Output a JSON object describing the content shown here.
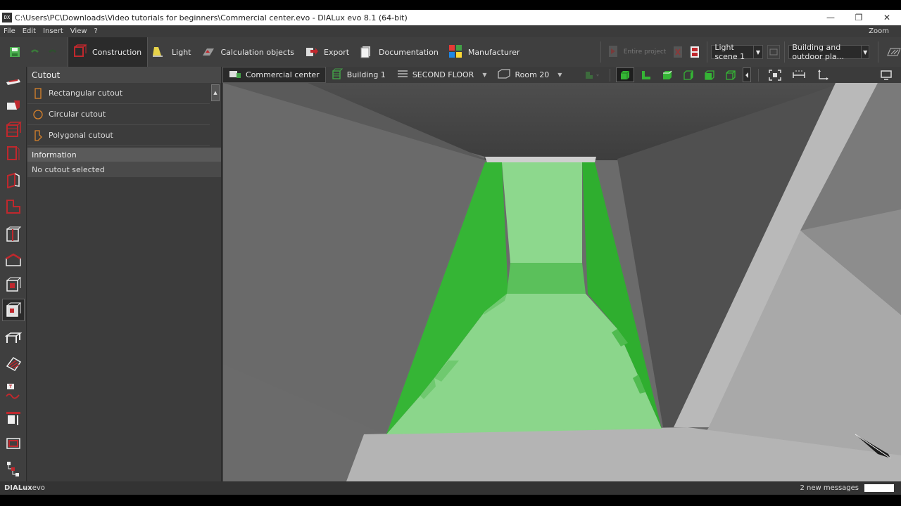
{
  "window": {
    "title": "C:\\Users\\PC\\Downloads\\Video tutorials for beginners\\Commercial center.evo - DIALux evo 8.1  (64-bit)",
    "app_icon": "DX",
    "min": "—",
    "max": "❐",
    "close": "✕"
  },
  "menu": {
    "items": [
      "File",
      "Edit",
      "Insert",
      "View",
      "?"
    ],
    "zoom": "Zoom"
  },
  "toolbar": {
    "construction": "Construction",
    "light": "Light",
    "calculation": "Calculation objects",
    "export": "Export",
    "documentation": "Documentation",
    "manufacturer": "Manufacturer",
    "entire_project": "Entire project",
    "light_scene": "Light scene 1",
    "building_plan": "Building and outdoor pla..."
  },
  "panel": {
    "title": "Cutout",
    "items": [
      {
        "label": "Rectangular cutout"
      },
      {
        "label": "Circular cutout"
      },
      {
        "label": "Polygonal cutout"
      }
    ],
    "info_title": "Information",
    "info_text": "No cutout selected"
  },
  "breadcrumb": {
    "project": "Commercial center",
    "building": "Building 1",
    "floor": "SECOND FLOOR",
    "room": "Room 20"
  },
  "status": {
    "brand_bold": "DIALux",
    "brand_rest": "evo",
    "messages": "2 new messages"
  },
  "colors": {
    "accent_red": "#c0282d",
    "select_green": "#35b535",
    "light_green": "#8bd68b"
  }
}
